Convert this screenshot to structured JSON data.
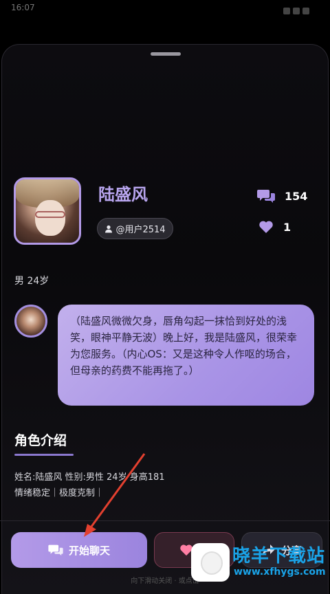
{
  "status_bar": {
    "time": "16:07"
  },
  "profile": {
    "name": "陆盛风",
    "user_id": "@用户2514",
    "chat_count": "154",
    "like_count": "1",
    "gender_age": "男 24岁"
  },
  "greeting": "（陆盛风微微欠身，唇角勾起一抹恰到好处的浅笑，眼神平静无波）晚上好，我是陆盛风，很荣幸为您服务。（内心OS：又是这种令人作呕的场合，但母亲的药费不能再拖了。）",
  "intro": {
    "title": "角色介绍",
    "line1": "姓名:陆盛风 性别:男性 24岁 身高181",
    "line2": "情绪稳定｜极度克制｜"
  },
  "actions": {
    "chat_label": "开始聊天",
    "fav_label": "加",
    "share_label": "分享"
  },
  "hint": "向下滑动关闭 · 或点击",
  "watermark": {
    "brand": "晓羊下载站",
    "url": "www.xfhygs.com"
  },
  "colors": {
    "accent": "#b39ae8",
    "bubble": "#a994e6",
    "like": "#b39ae8"
  },
  "icons": [
    "chat-bubbles-icon",
    "heart-icon",
    "user-icon",
    "share-icon"
  ]
}
